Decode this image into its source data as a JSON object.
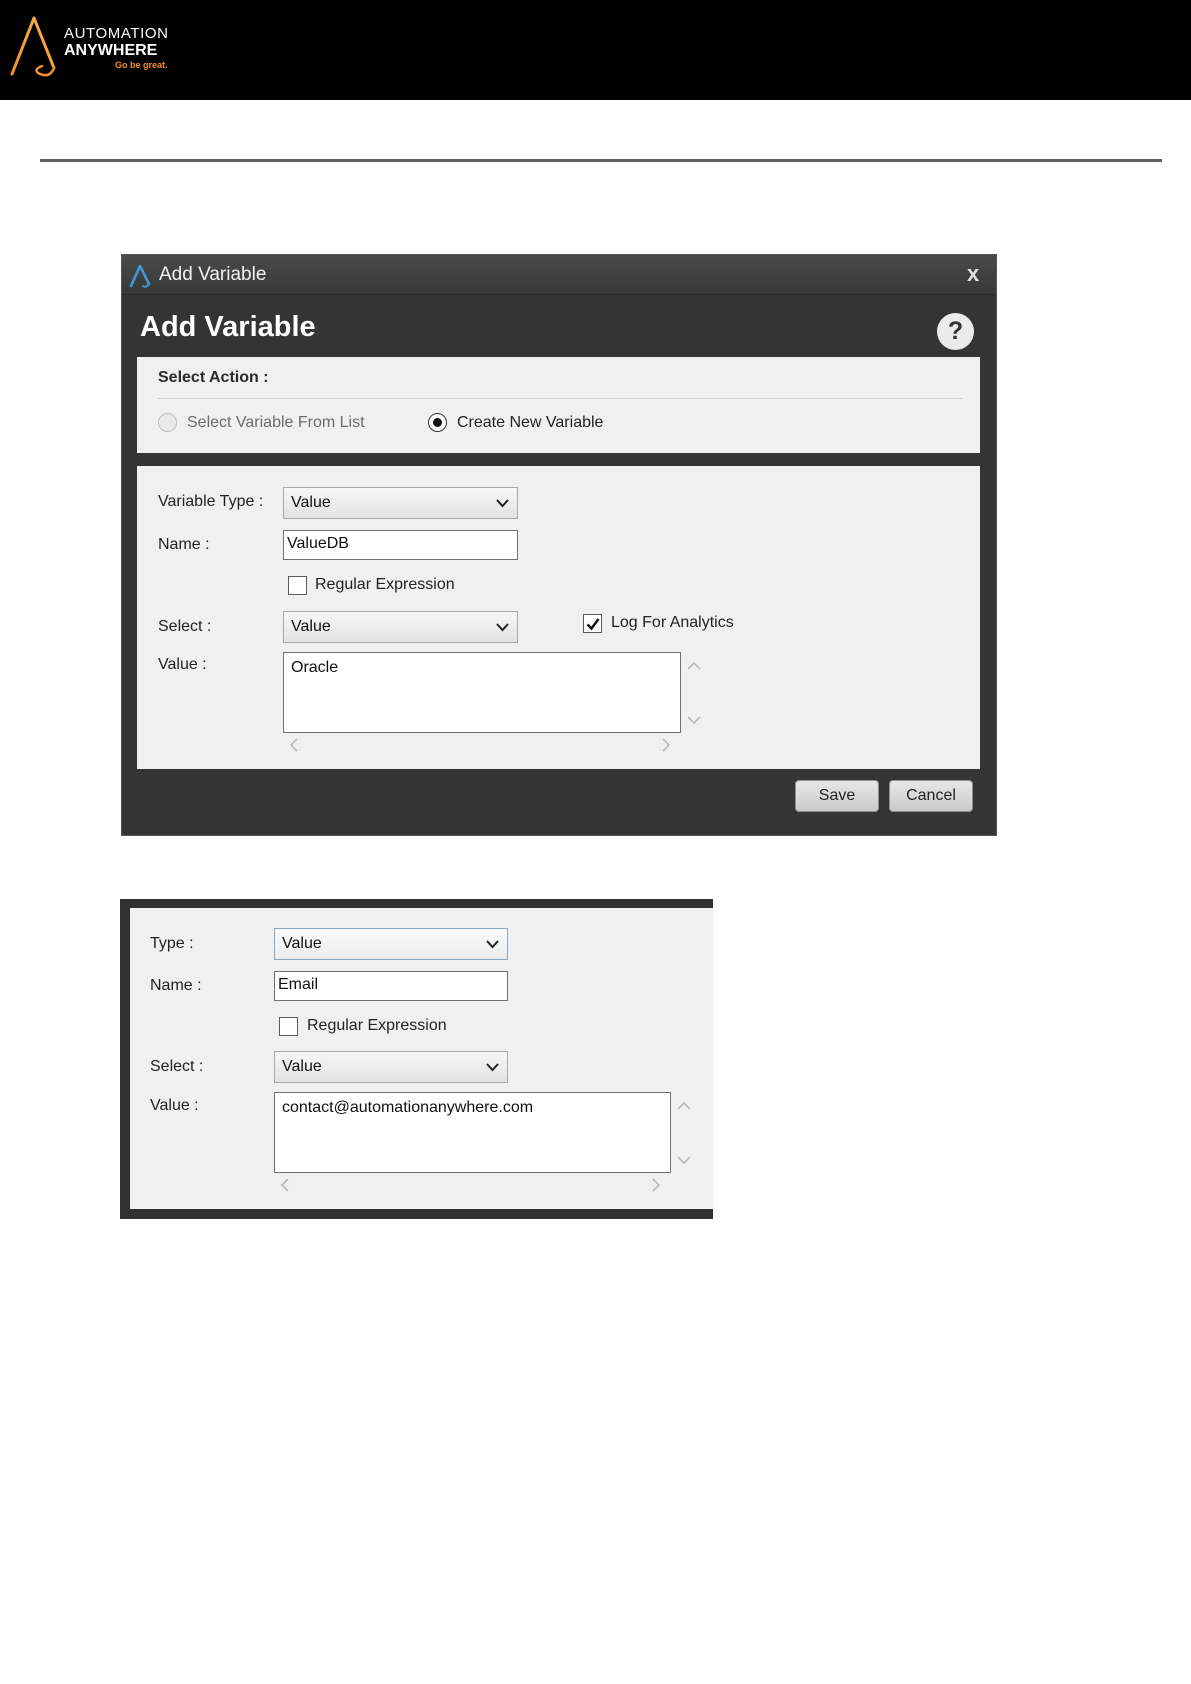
{
  "header": {
    "logo_line1": "AUTOMATION",
    "logo_line2": "ANYWHERE",
    "tagline": "Go be great.",
    "accent_color": "#f2912a",
    "background": "#000000"
  },
  "dialog1": {
    "window_title": "Add Variable",
    "heading": "Add Variable",
    "close_glyph": "x",
    "help_glyph": "?",
    "select_action": {
      "label": "Select Action :",
      "option_list": "Select Variable From List",
      "option_new": "Create New Variable",
      "selected": "Create New Variable"
    },
    "form": {
      "type_label": "Variable Type :",
      "type_value": "Value",
      "name_label": "Name :",
      "name_value": "ValueDB",
      "regex_label": "Regular Expression",
      "regex_checked": false,
      "select_label": "Select :",
      "select_value": "Value",
      "log_label": "Log For Analytics",
      "log_checked": true,
      "value_label": "Value :",
      "value_text": "Oracle"
    },
    "buttons": {
      "save": "Save",
      "cancel": "Cancel"
    }
  },
  "dialog2": {
    "form": {
      "type_label": "Type :",
      "type_value": "Value",
      "name_label": "Name :",
      "name_value": "Email",
      "regex_label": "Regular Expression",
      "regex_checked": false,
      "select_label": "Select :",
      "select_value": "Value",
      "value_label": "Value :",
      "value_text": "contact@automationanywhere.com"
    }
  }
}
